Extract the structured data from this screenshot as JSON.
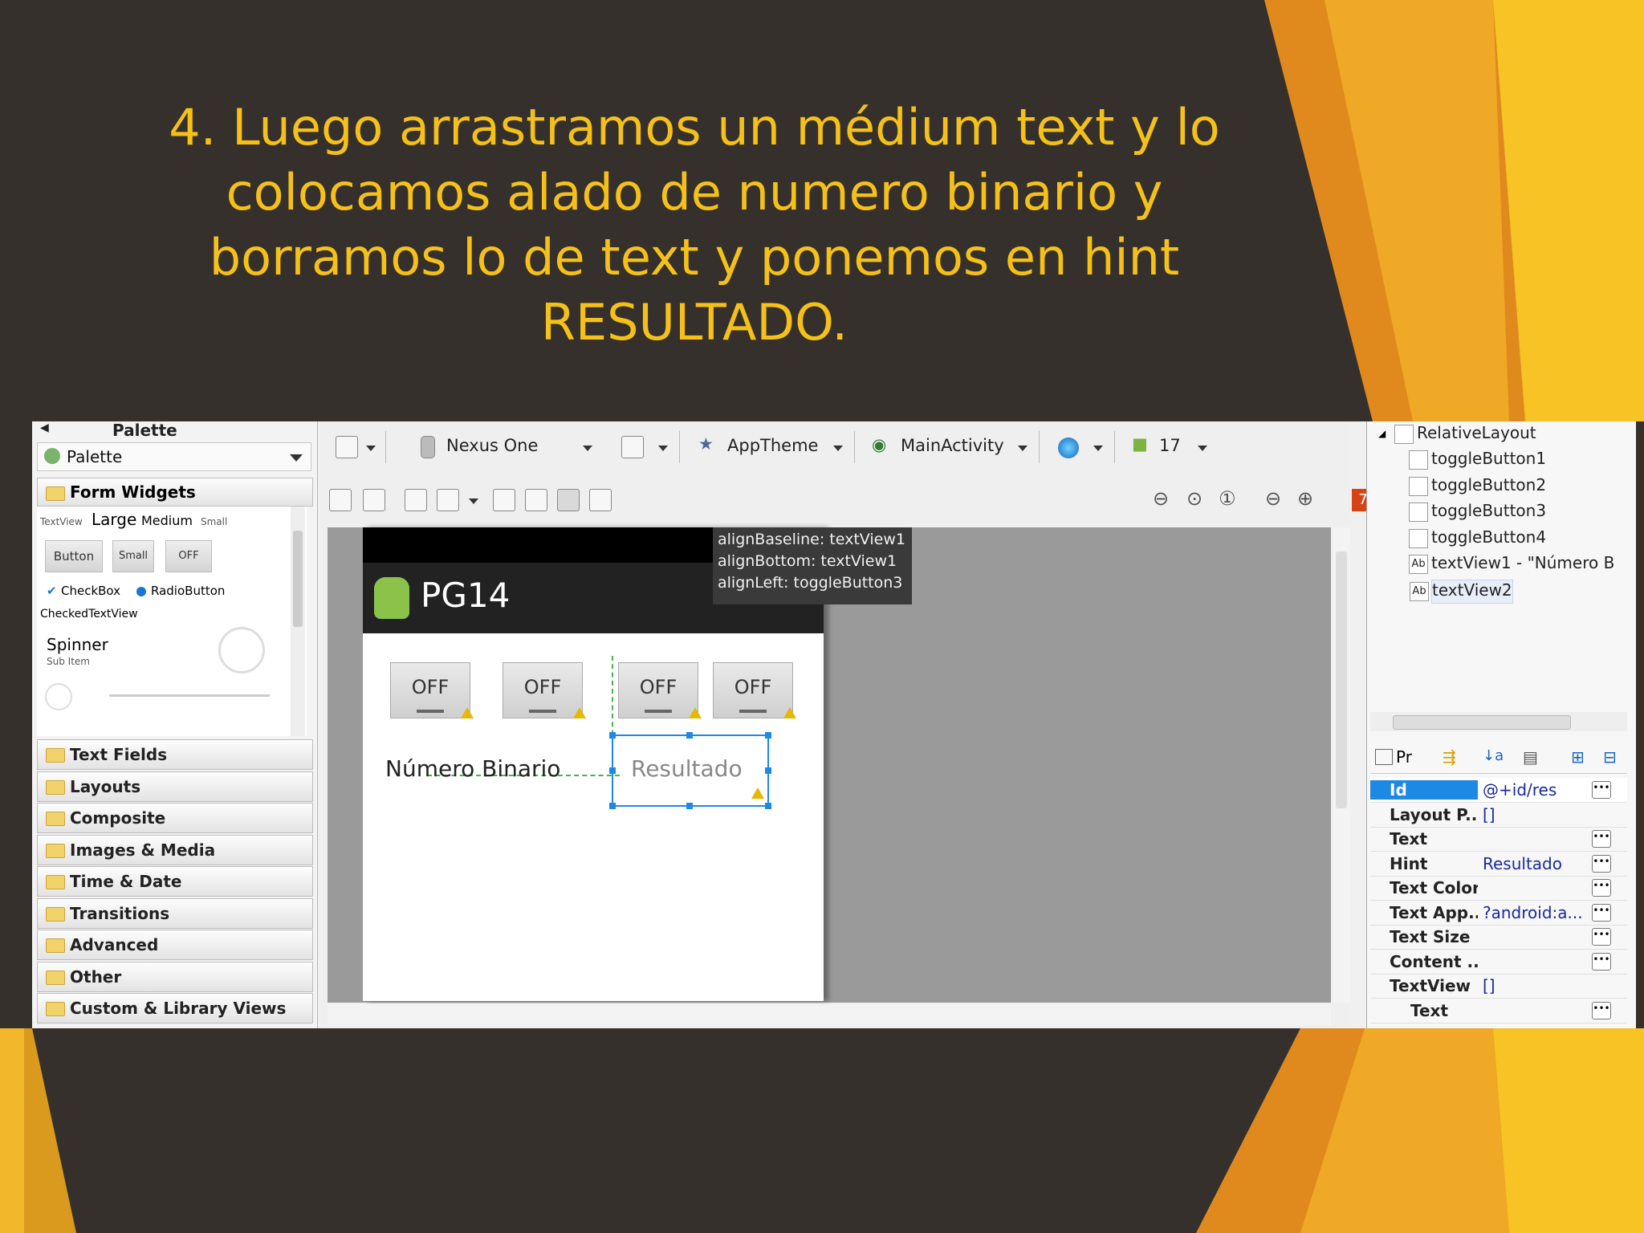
{
  "slide": {
    "title": "4. Luego arrastramos un médium text y lo\ncolocamos alado de numero binario y\nborramos lo de text y ponemos en hint\nRESULTADO."
  },
  "palette": {
    "header": "Palette",
    "selector": "Palette",
    "open_group": "Form Widgets",
    "widgets": {
      "textview": "TextView",
      "large": "Large",
      "medium": "Medium",
      "small": "Small",
      "button": "Button",
      "small_button": "Small",
      "off": "OFF",
      "checkbox": "CheckBox",
      "radio": "RadioButton",
      "checked_text": "CheckedTextView",
      "spinner": "Spinner",
      "spinner_sub": "Sub Item"
    },
    "groups": [
      "Text Fields",
      "Layouts",
      "Composite",
      "Images & Media",
      "Time & Date",
      "Transitions",
      "Advanced",
      "Other",
      "Custom & Library Views"
    ]
  },
  "toolbar": {
    "device": "Nexus One",
    "theme": "AppTheme",
    "activity": "MainActivity",
    "api": "17",
    "error_count": "7"
  },
  "device": {
    "app_title": "PG14",
    "toggles": [
      "OFF",
      "OFF",
      "OFF",
      "OFF"
    ],
    "label": "Número Binario",
    "hint": "Resultado"
  },
  "tooltip": [
    "alignBaseline: textView1",
    "alignBottom: textView1",
    "alignLeft: toggleButton3"
  ],
  "outline": {
    "root": "RelativeLayout",
    "children": [
      "toggleButton1",
      "toggleButton2",
      "toggleButton3",
      "toggleButton4",
      "textView1 - \"Número B",
      "textView2"
    ]
  },
  "properties": {
    "tab_label": "Pr",
    "rows": [
      {
        "name": "Id",
        "value": "@+id/res"
      },
      {
        "name": "Layout P...",
        "value": "[]"
      },
      {
        "name": "Text",
        "value": ""
      },
      {
        "name": "Hint",
        "value": "Resultado"
      },
      {
        "name": "Text Color",
        "value": ""
      },
      {
        "name": "Text App...",
        "value": "?android:a..."
      },
      {
        "name": "Text Size",
        "value": ""
      },
      {
        "name": "Content ...",
        "value": ""
      },
      {
        "name": "TextView",
        "value": "[]"
      },
      {
        "name": "Text",
        "value": ""
      }
    ]
  },
  "colors": {
    "slide_bg": "#35302b",
    "title": "#f5c118",
    "selection": "#1e88e5"
  }
}
